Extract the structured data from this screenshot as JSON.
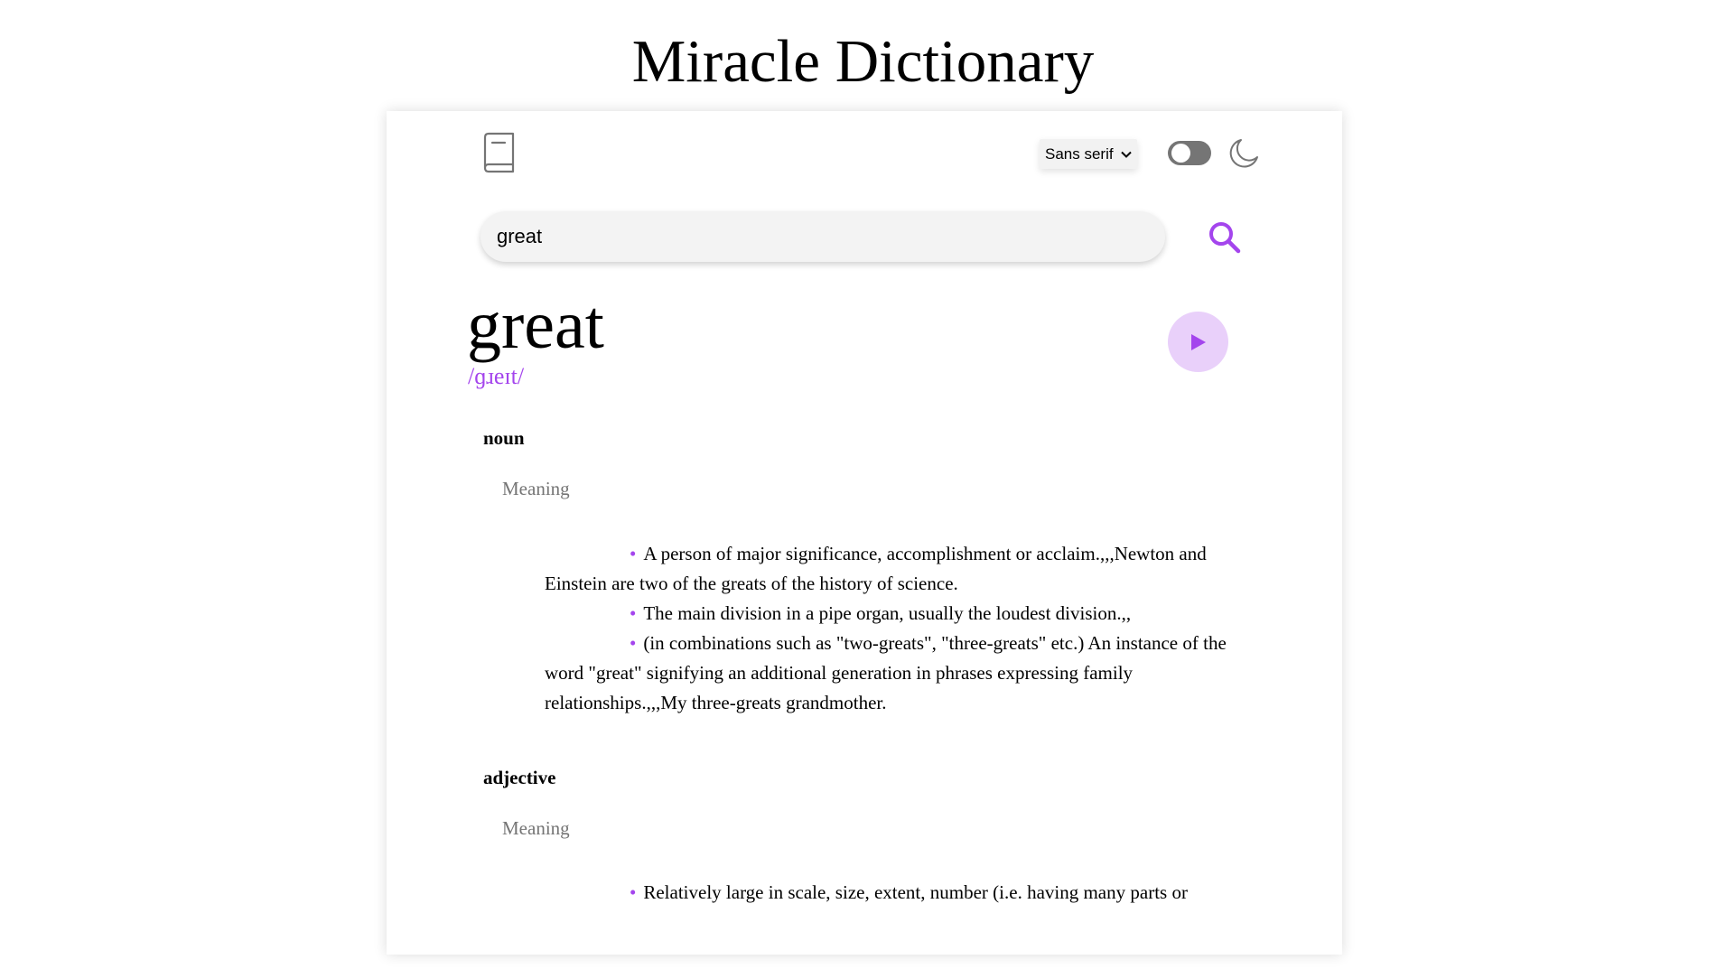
{
  "app": {
    "title": "Miracle Dictionary"
  },
  "toolbar": {
    "font_select_value": "Sans serif",
    "theme_toggle_on": false
  },
  "search": {
    "value": "great"
  },
  "entry": {
    "word": "great",
    "phonetic": "/ɡɹeɪt/",
    "meanings": [
      {
        "part_of_speech": "noun",
        "label": "Meaning",
        "definitions": [
          "A person of major significance, accomplishment or acclaim.,,,Newton and Einstein are two of the greats of the history of science.",
          "The main division in a pipe organ, usually the loudest division.,,",
          "(in combinations such as \"two-greats\", \"three-greats\" etc.) An instance of the word \"great\" signifying an additional generation in phrases expressing family relationships.,,,My three-greats grandmother."
        ]
      },
      {
        "part_of_speech": "adjective",
        "label": "Meaning",
        "definitions": [
          "Relatively large in scale, size, extent, number (i.e. having many parts or"
        ]
      }
    ]
  },
  "colors": {
    "accent": "#a445ed",
    "accent_light": "#e9d0fa",
    "muted_text": "#757575",
    "search_bg": "#f3f3f3"
  },
  "icons": {
    "logo": "book-icon",
    "theme": "moon-icon",
    "search": "search-icon",
    "audio": "play-icon",
    "select": "chevron-down-icon"
  }
}
